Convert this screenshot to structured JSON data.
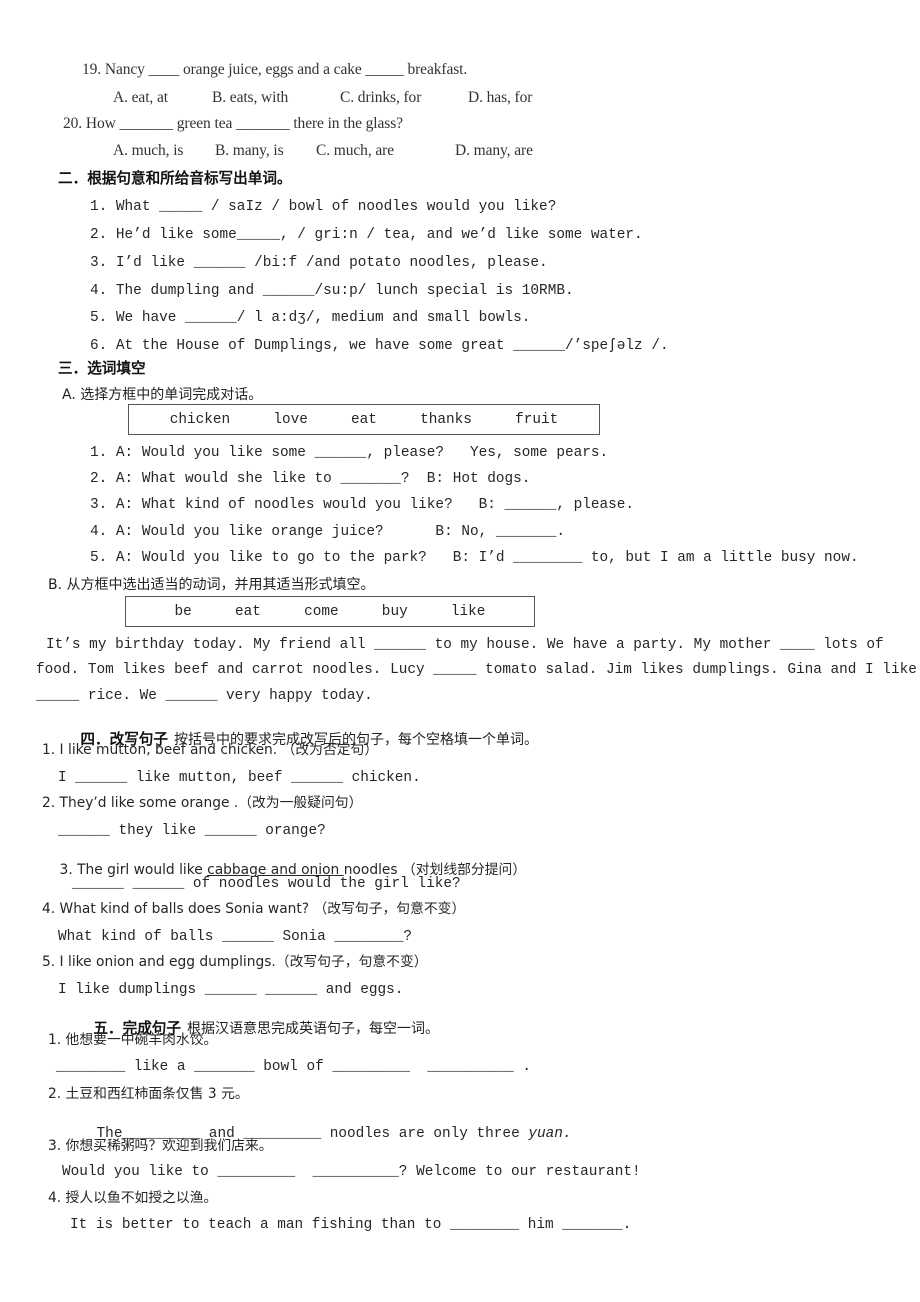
{
  "document": {
    "title": "English exercise worksheet page",
    "background_color": "#ffffff",
    "text_color": "#262626"
  },
  "multiple_choice": {
    "items": [
      {
        "stem": "19. Nancy ____ orange juice, eggs and a cake _____ breakfast.",
        "options": [
          "A. eat, at",
          "B. eats, with",
          "C. drinks, for",
          "D. has, for"
        ]
      },
      {
        "stem": "20. How _______ green tea _______ there in the glass?",
        "options": [
          "A. much, is",
          "B. many, is",
          "C. much, are",
          "D. many, are"
        ]
      }
    ]
  },
  "section_two": {
    "heading": "二．根据句意和所给音标写出单词。",
    "items": [
      "1. What _____ / saIz / bowl of noodles would you like?",
      "2. He’d like some_____, / gri:n / tea, and we’d like some water.",
      "3. I’d like ______ /bi:f /and potato noodles, please.",
      "4. The dumpling and ______/su:p/ lunch special is 10RMB.",
      "5. We have ______/ l a:dʒ/, medium and small bowls.",
      "6. At the House of Dumplings, we have some great ______/’speʃəlz /."
    ]
  },
  "section_three": {
    "heading": "三．选词填空",
    "part_a": {
      "label": "A. 选择方框中的单词完成对话。",
      "word_bank": [
        "chicken",
        "love",
        "eat",
        "thanks",
        "fruit"
      ],
      "items": [
        "1. A: Would you like some ______, please?   Yes, some pears.",
        "2. A: What would she like to _______?  B: Hot dogs.",
        "3. A: What kind of noodles would you like?   B: ______, please.",
        "4. A: Would you like orange juice?      B: No, _______.",
        "5. A: Would you like to go to the park?   B: I’d ________ to, but I am a little busy now."
      ]
    },
    "part_b": {
      "label": "B. 从方框中选出适当的动词，并用其适当形式填空。",
      "word_bank": [
        "be",
        "eat",
        "come",
        "buy",
        "like"
      ],
      "paragraph": [
        "It’s my birthday today. My friend all ______ to my house. We have a party. My mother ____ lots of",
        "food. Tom likes beef and carrot noodles. Lucy _____ tomato salad. Jim likes dumplings. Gina and I like",
        "_____ rice. We ______ very happy today."
      ]
    }
  },
  "section_four": {
    "heading_bold": "四．改写句子",
    "heading_rest": "按括号中的要求完成改写后的句子，每个空格填一个单词。",
    "items": [
      {
        "prompt": "1. I like mutton, beef and chicken. （改为否定句）",
        "answer_line": "I ______ like mutton, beef ______ chicken."
      },
      {
        "prompt": "2. They’d like some orange .（改为一般疑问句）",
        "answer_line": "______ they like ______ orange?"
      },
      {
        "prompt_pre": "3. The girl would like ",
        "prompt_underlined": "cabbage and onion ",
        "prompt_post": "noodles （对划线部分提问）",
        "answer_line": "______ ______ of noodles would the girl like?"
      },
      {
        "prompt": "4. What kind of balls does Sonia want? （改写句子，句意不变）",
        "answer_line": "What kind of balls ______ Sonia ________?"
      },
      {
        "prompt": "5. I like onion and egg dumplings.（改写句子，句意不变）",
        "answer_line": "I like dumplings ______ ______ and eggs."
      }
    ]
  },
  "section_five": {
    "heading_bold": "五．完成句子",
    "heading_rest": "根据汉语意思完成英语句子，每空一词。",
    "items": [
      {
        "chinese": "1. 他想要一中碗羊肉水饺。",
        "english": "________ like a _______ bowl of _________  __________ ."
      },
      {
        "chinese": "2. 土豆和西红柿面条仅售 3 元。",
        "english_pre": "The_________ and _________ noodles are only three ",
        "english_italic": "yuan."
      },
      {
        "chinese": "3. 你想买稀粥吗？欢迎到我们店来。",
        "english": "Would you like to _________  __________? Welcome to our restaurant!"
      },
      {
        "chinese": "4. 授人以鱼不如授之以渔。",
        "english": "It is better to teach a man fishing than to ________ him _______."
      }
    ]
  },
  "watermark": {
    "text": ""
  }
}
